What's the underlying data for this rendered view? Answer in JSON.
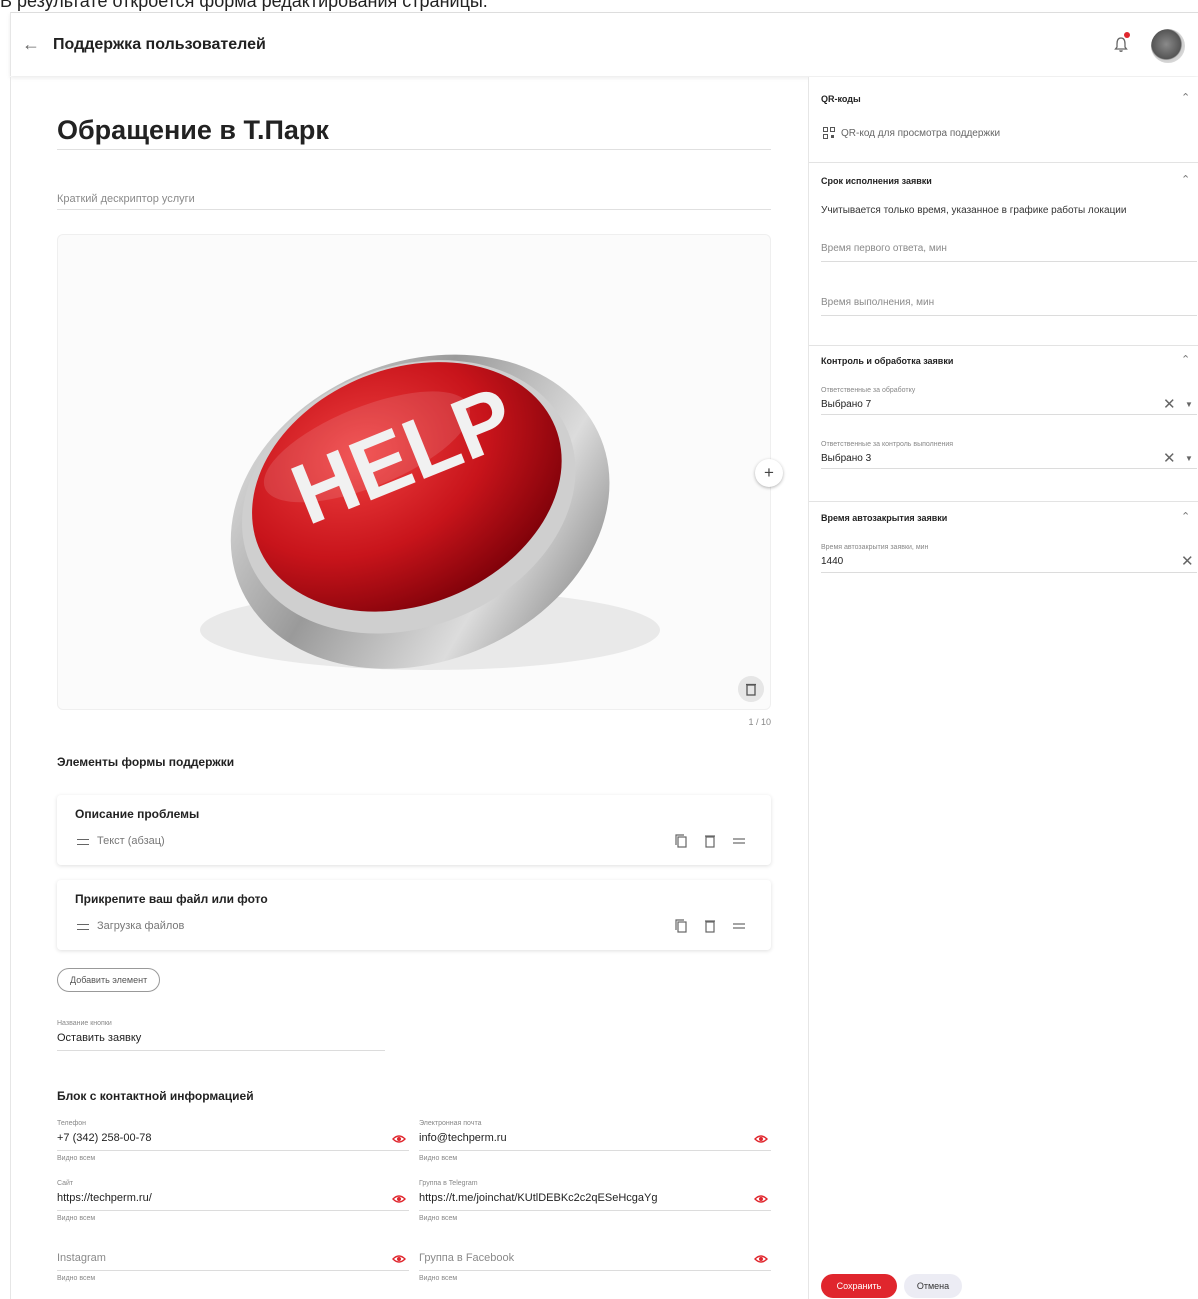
{
  "caption": "В результате откроется форма редактирования страницы.",
  "appbar": {
    "title": "Поддержка пользователей"
  },
  "main": {
    "page_title": "Обращение в Т.Парк",
    "subtitle_placeholder": "Краткий дескриптор услуги",
    "image_word": "HELP",
    "image_counter": "1 / 10",
    "form_section_title": "Элементы формы поддержки",
    "elements": [
      {
        "title": "Описание проблемы",
        "type": "Текст (абзац)"
      },
      {
        "title": "Прикрепите ваш файл или фото",
        "type": "Загрузка файлов"
      }
    ],
    "add_element_label": "Добавить элемент",
    "button_name_label": "Название кнопки",
    "button_name_value": "Оставить заявку",
    "contacts_title": "Блок с контактной информацией",
    "contacts": {
      "phone": {
        "label": "Телефон",
        "value": "+7 (342) 258-00-78",
        "hint": "Видно всем"
      },
      "email": {
        "label": "Электронная почта",
        "value": "info@techperm.ru",
        "hint": "Видно всем"
      },
      "site": {
        "label": "Сайт",
        "value": "https://techperm.ru/",
        "hint": "Видно всем"
      },
      "telegram": {
        "label": "Группа в Telegram",
        "value": "https://t.me/joinchat/KUtlDEBKc2c2qESeHcgaYg",
        "hint": "Видно всем"
      },
      "instagram": {
        "placeholder": "Instagram",
        "hint": "Видно всем"
      },
      "facebook": {
        "placeholder": "Группа в Facebook",
        "hint": "Видно всем"
      }
    }
  },
  "side": {
    "qr": {
      "title": "QR-коды",
      "link": "QR-код для просмотра поддержки"
    },
    "deadline": {
      "title": "Срок исполнения заявки",
      "note": "Учитывается только время, указанное в графике работы локации",
      "first_response_placeholder": "Время первого ответа, мин",
      "completion_placeholder": "Время выполнения, мин"
    },
    "control": {
      "title": "Контроль и обработка заявки",
      "processing_label": "Ответственные за обработку",
      "processing_value": "Выбрано 7",
      "control_label": "Ответственные за контроль выполнения",
      "control_value": "Выбрано 3"
    },
    "autoclose": {
      "title": "Время автозакрытия заявки",
      "label": "Время автозакрытия заявки, мин",
      "value": "1440"
    },
    "save_label": "Сохранить",
    "cancel_label": "Отмена"
  },
  "colors": {
    "accent": "#e0262d",
    "help_red": "#c8141b",
    "chrome": "#b8b8b8"
  },
  "icons": [
    "back-arrow-icon",
    "bell-icon",
    "qr-icon",
    "copy-icon",
    "trash-icon",
    "drag-handle-icon",
    "eye-icon",
    "plus-icon",
    "chevron-up-icon",
    "close-icon",
    "caret-down-icon"
  ]
}
